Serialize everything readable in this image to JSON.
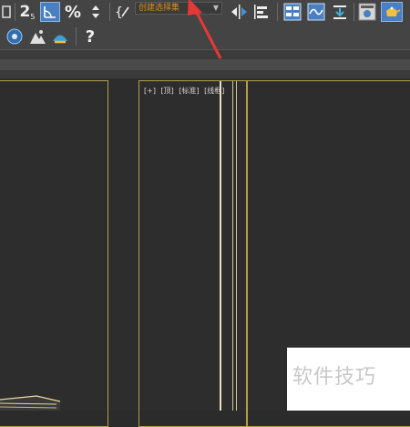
{
  "toolbar": {
    "selection_set_placeholder": "创建选择集",
    "snap_label": "2",
    "snap_sub": "5",
    "percent_label": "%",
    "help_label": "?"
  },
  "viewport": {
    "labels": [
      "[+]",
      "[顶]",
      "[标准]",
      "[线框]"
    ]
  },
  "watermark": {
    "text": "软件技巧"
  },
  "colors": {
    "toolbar_bg": "#444444",
    "viewport_bg": "#2d2d2d",
    "viewport_border": "#b59f4a",
    "accent_blue": "#4a7fc1",
    "dropdown_text": "#d9901e",
    "arrow_red": "#e53935"
  }
}
